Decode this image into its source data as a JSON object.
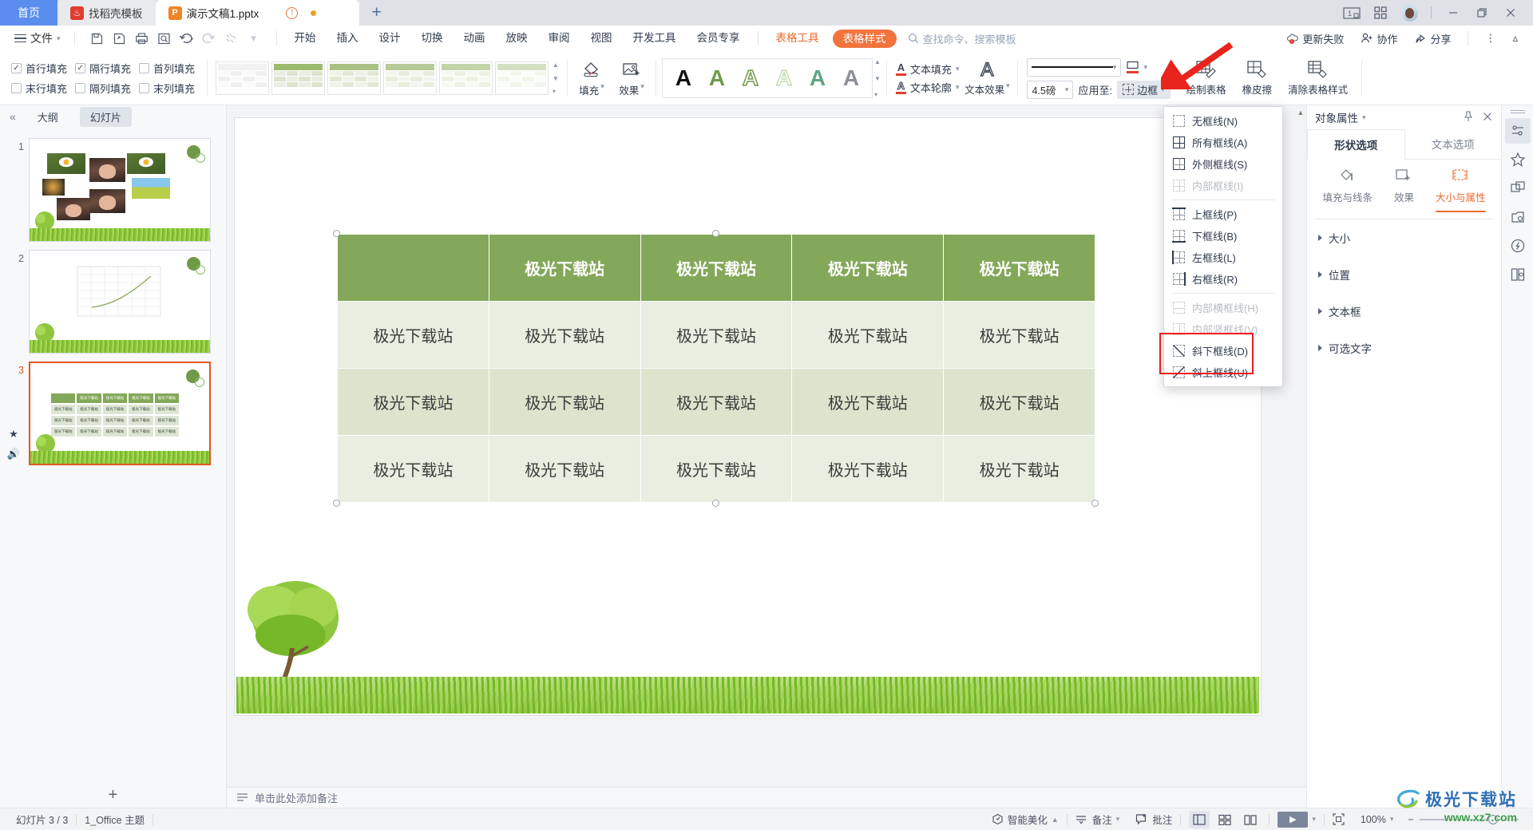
{
  "titlebar": {
    "home_tab": "首页",
    "template_tab": "找稻壳模板",
    "doc_tab": "演示文稿1.pptx",
    "warn_icon": "warning-circle-icon",
    "add_tab": "+",
    "window_buttons": [
      "restore-count-icon",
      "grid-apps-icon",
      "user-avatar",
      "minimize-icon",
      "maximize-icon",
      "close-icon"
    ]
  },
  "menubar": {
    "file": "文件",
    "quick_access": [
      "save-icon",
      "save-as-icon",
      "print-icon",
      "print-preview-icon",
      "undo-icon",
      "redo-icon",
      "format-painter-icon",
      "customize-icon"
    ],
    "items": [
      "开始",
      "插入",
      "设计",
      "切换",
      "动画",
      "放映",
      "审阅",
      "视图",
      "开发工具",
      "会员专享"
    ],
    "tool_label": "表格工具",
    "active_tab": "表格样式",
    "search_placeholder": "查找命令、搜索模板",
    "update": "更新失败",
    "collab": "协作",
    "share": "分享"
  },
  "ribbon": {
    "checkboxes": [
      {
        "label": "首行填充",
        "checked": true
      },
      {
        "label": "隔行填充",
        "checked": true
      },
      {
        "label": "首列填充",
        "checked": false
      },
      {
        "label": "末行填充",
        "checked": false
      },
      {
        "label": "隔列填充",
        "checked": false
      },
      {
        "label": "末列填充",
        "checked": false
      }
    ],
    "fill_label": "填充",
    "effect_label": "效果",
    "wordart_styles": [
      "A",
      "A",
      "A",
      "A",
      "A",
      "A"
    ],
    "text_fill": "文本填充",
    "text_outline": "文本轮廓",
    "text_effect": "文本效果",
    "line_width": "4.5磅",
    "apply_to": "应用至:",
    "border_button": "边框",
    "draw_table": "绘制表格",
    "eraser": "橡皮擦",
    "clear_style": "清除表格样式"
  },
  "dropdown": {
    "items": [
      {
        "label": "无框线(N)",
        "icon": "no-border-icon",
        "disabled": false,
        "sep_after": false
      },
      {
        "label": "所有框线(A)",
        "icon": "all-borders-icon",
        "disabled": false,
        "sep_after": false
      },
      {
        "label": "外侧框线(S)",
        "icon": "outside-borders-icon",
        "disabled": false,
        "sep_after": false
      },
      {
        "label": "内部框线(I)",
        "icon": "inside-borders-icon",
        "disabled": true,
        "sep_after": true
      },
      {
        "label": "上框线(P)",
        "icon": "top-border-icon",
        "disabled": false,
        "sep_after": false
      },
      {
        "label": "下框线(B)",
        "icon": "bottom-border-icon",
        "disabled": false,
        "sep_after": false
      },
      {
        "label": "左框线(L)",
        "icon": "left-border-icon",
        "disabled": false,
        "sep_after": false
      },
      {
        "label": "右框线(R)",
        "icon": "right-border-icon",
        "disabled": false,
        "sep_after": true
      },
      {
        "label": "内部横框线(H)",
        "icon": "inside-horizontal-border-icon",
        "disabled": true,
        "sep_after": false
      },
      {
        "label": "内部竖框线(V)",
        "icon": "inside-vertical-border-icon",
        "disabled": true,
        "sep_after": false
      },
      {
        "label": "斜下框线(D)",
        "icon": "diagonal-down-border-icon",
        "disabled": false,
        "sep_after": false
      },
      {
        "label": "斜上框线(U)",
        "icon": "diagonal-up-border-icon",
        "disabled": false,
        "sep_after": false
      }
    ],
    "highlight_color": "#ee1b24",
    "arrow_color": "#e8241c"
  },
  "slidepanel": {
    "outline_tab": "大纲",
    "slides_tab": "幻灯片",
    "slides": [
      {
        "number": "1",
        "selected": false
      },
      {
        "number": "2",
        "selected": false
      },
      {
        "number": "3",
        "selected": true
      }
    ],
    "add_slide": "+"
  },
  "slide": {
    "table": {
      "columns": 5,
      "rows": [
        {
          "type": "head",
          "cells": [
            "",
            "极光下载站",
            "极光下载站",
            "极光下载站",
            "极光下载站"
          ]
        },
        {
          "type": "odd",
          "cells": [
            "极光下载站",
            "极光下载站",
            "极光下载站",
            "极光下载站",
            "极光下载站"
          ]
        },
        {
          "type": "even",
          "cells": [
            "极光下载站",
            "极光下载站",
            "极光下载站",
            "极光下载站",
            "极光下载站"
          ]
        },
        {
          "type": "odd",
          "cells": [
            "极光下载站",
            "极光下载站",
            "极光下载站",
            "极光下载站",
            "极光下载站"
          ]
        }
      ],
      "header_color": "#84a85a",
      "row_odd_color": "#e8eee0",
      "row_even_color": "#dbe5cd"
    }
  },
  "rightpanel": {
    "title": "对象属性",
    "tabs": [
      "形状选项",
      "文本选项"
    ],
    "active_tab": "形状选项",
    "icon_tabs": [
      {
        "label": "填充与线条",
        "active": false
      },
      {
        "label": "效果",
        "active": false
      },
      {
        "label": "大小与属性",
        "active": true
      }
    ],
    "sections": [
      "大小",
      "位置",
      "文本框",
      "可选文字"
    ],
    "accent_color": "#ec6b2d"
  },
  "rail": {
    "buttons": [
      "properties-icon",
      "star-icon",
      "shapes-icon",
      "material-icon",
      "idea-icon",
      "reader-icon"
    ]
  },
  "notes": {
    "placeholder": "单击此处添加备注"
  },
  "statusbar": {
    "slide_count": "幻灯片 3 / 3",
    "theme": "1_Office 主题",
    "beautify": "智能美化",
    "notes": "备注",
    "comments": "批注",
    "views": [
      "normal-view-icon",
      "slide-sorter-icon",
      "reading-view-icon"
    ],
    "play": "play-icon",
    "fit_icon": "fit-to-window-icon",
    "zoom": "100%",
    "zoom_out": "−",
    "zoom_in": "+"
  },
  "watermark": {
    "title": "极光下载站",
    "url": "www.xz7.com"
  }
}
